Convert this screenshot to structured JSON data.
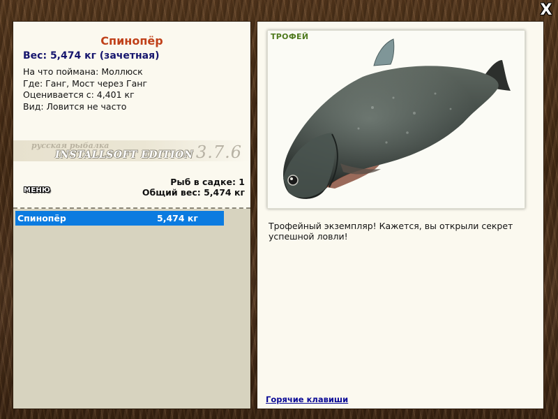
{
  "window": {
    "close_label": "X"
  },
  "fish": {
    "name": "Спинопёр",
    "weight_line": "Вес: 5,474 кг (зачетная)",
    "bait_line": "На что поймана: Моллюск",
    "location_line": "Где: Ганг, Мост через Ганг",
    "rating_line": "Оценивается с: 4,401 кг",
    "rarity_line": "Вид: Ловится не часто"
  },
  "logo": {
    "top_text": "русская рыбалка",
    "main_text": "INSTALLSOFT EDITION",
    "version": "3.7.6"
  },
  "menu_button": {
    "label": "МЕНЮ"
  },
  "keep": {
    "count_line": "Рыб в садке: 1",
    "total_line": "Общий вес: 5,474 кг"
  },
  "catch_list": [
    {
      "name": "Спинопёр",
      "weight": "5,474 кг",
      "selected": true
    }
  ],
  "photo": {
    "badge": "ТРОФЕЙ"
  },
  "description": "Трофейный экземпляр! Кажется, вы открыли секрет успешной ловли!",
  "hotkeys_link": "Горячие клавиши",
  "colors": {
    "fish_name": "#c0411a",
    "weight_text": "#16166e",
    "selection": "#0b7be0",
    "trophy_badge": "#4f7a1e",
    "link": "#0a0a96",
    "panel_bg": "#fbf9ef",
    "list_bg": "#d7d3bf"
  }
}
